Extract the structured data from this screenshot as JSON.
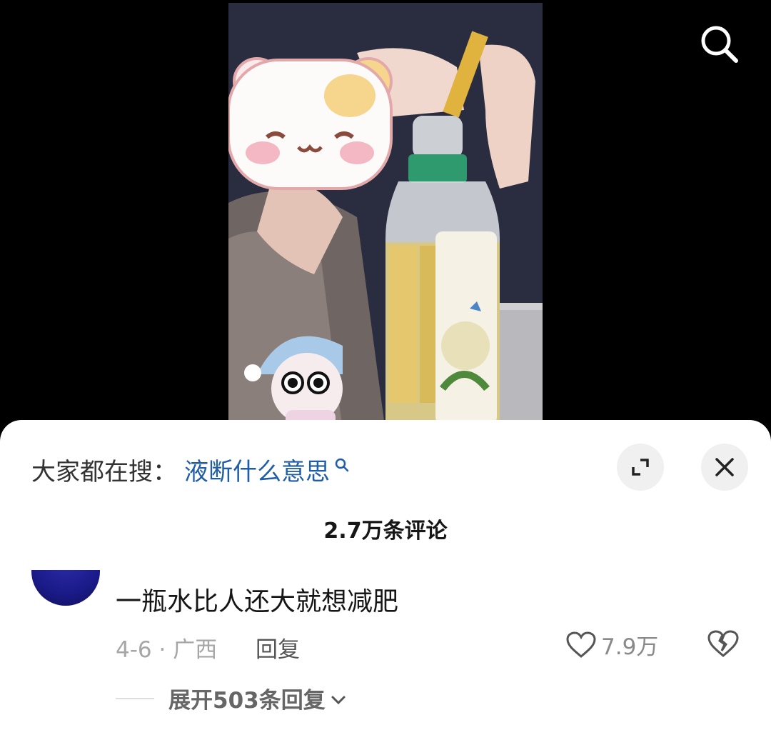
{
  "video": {
    "area": "video-frame"
  },
  "icons": {
    "search": "search-icon",
    "expand": "expand-icon",
    "close": "close-icon",
    "heart": "heart-icon",
    "dislike": "broken-heart-icon",
    "chevron": "chevron-down-icon"
  },
  "trending": {
    "prefix": "大家都在搜：",
    "query": "液断什么意思"
  },
  "comments_header": {
    "count_label": "2.7万条评论"
  },
  "comment": {
    "text": "一瓶水比人还大就想减肥",
    "date_location": "4-6 · 广西",
    "reply_label": "回复",
    "likes": "7.9万",
    "expand_label": "展开503条回复"
  },
  "colors": {
    "link": "#1f5da8",
    "sheet_bg": "#ffffff",
    "avatar": "#1b1a8a"
  }
}
